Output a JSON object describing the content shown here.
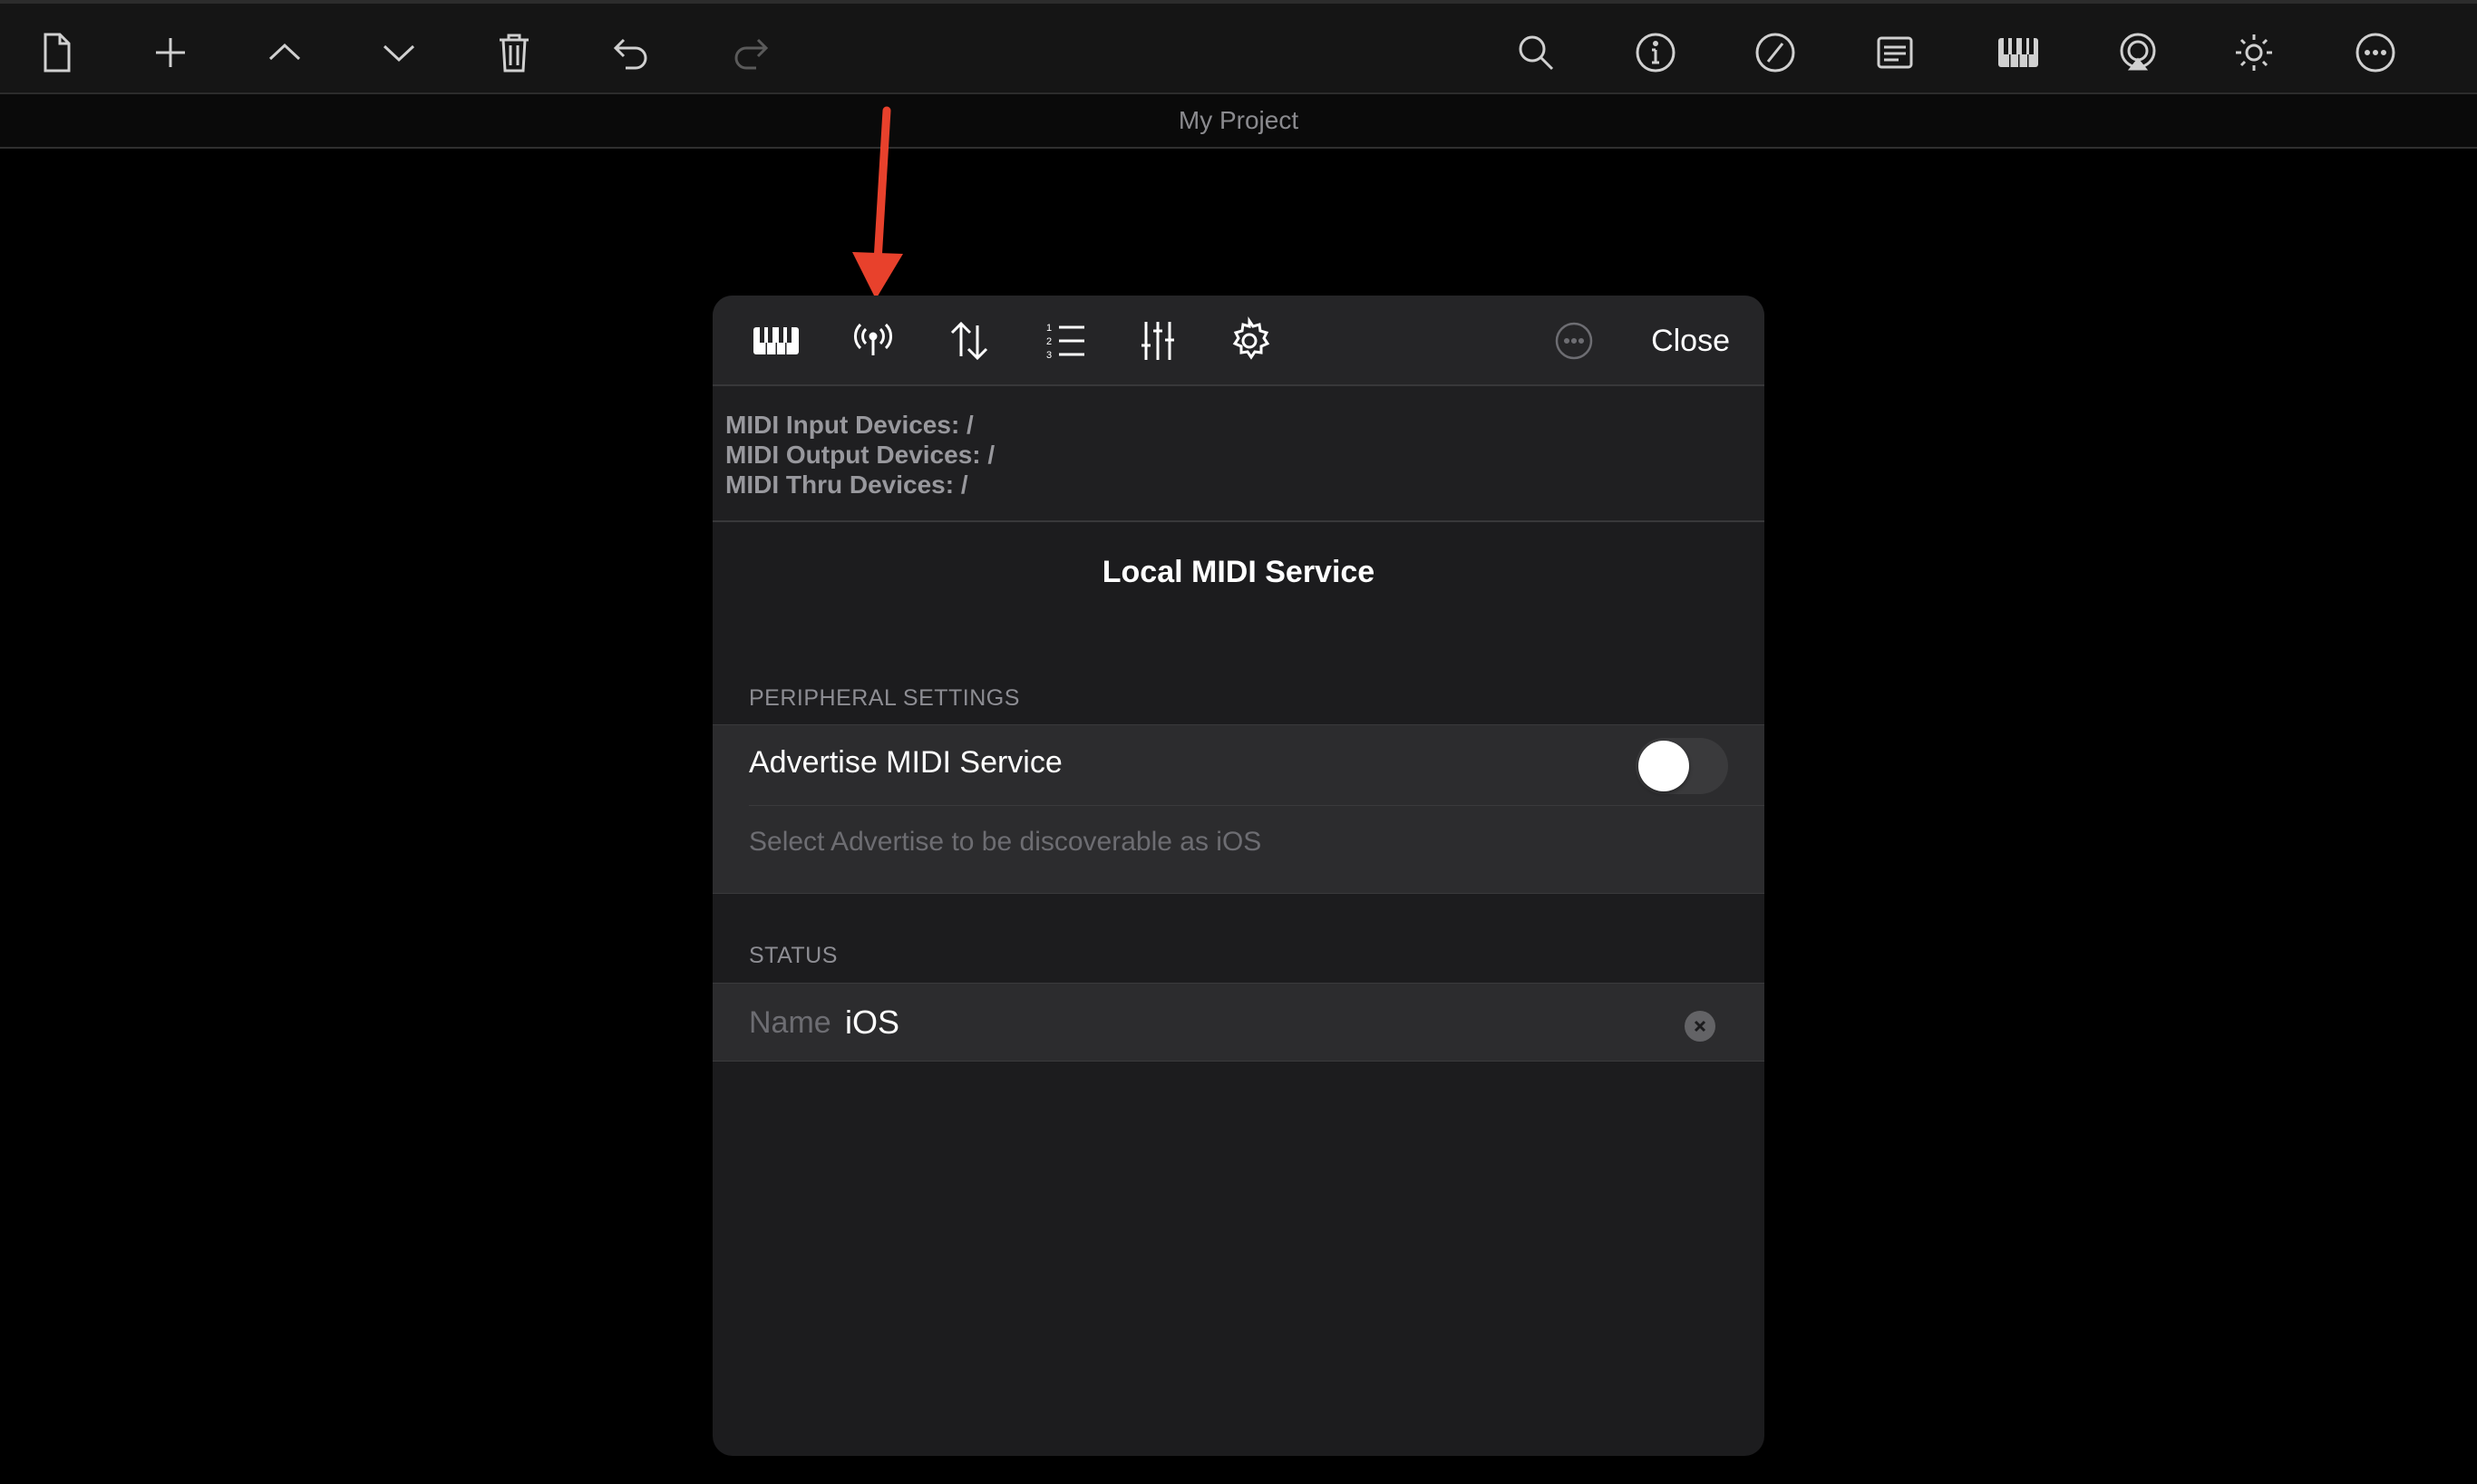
{
  "window": {
    "title": "My Project"
  },
  "toolbar": {
    "left_icons": [
      "new-document-icon",
      "plus-icon",
      "chevron-up-icon",
      "chevron-down-icon",
      "trash-icon",
      "undo-icon",
      "redo-icon"
    ],
    "right_icons": [
      "search-icon",
      "info-icon",
      "no-entry-icon",
      "notes-icon",
      "piano-keys-icon",
      "airplay-icon",
      "brightness-icon",
      "more-icon"
    ]
  },
  "panel": {
    "tabs": [
      "piano-keys-icon",
      "antenna-icon",
      "up-down-arrows-icon",
      "numbered-list-icon",
      "sliders-icon",
      "settings-gear-icon"
    ],
    "close_label": "Close",
    "devices": {
      "input": "MIDI Input Devices: /",
      "output": "MIDI Output Devices: /",
      "thru": "MIDI Thru Devices: /"
    },
    "service_title": "Local MIDI Service",
    "peripheral": {
      "header": "PERIPHERAL SETTINGS",
      "advertise_label": "Advertise MIDI Service",
      "advertise_on": false,
      "hint": "Select Advertise to be discoverable as iOS"
    },
    "status": {
      "header": "STATUS",
      "name_label": "Name",
      "name_value": "iOS"
    }
  },
  "colors": {
    "accent_arrow": "#e8412c",
    "background": "#000000",
    "panel": "#1c1c1e"
  }
}
